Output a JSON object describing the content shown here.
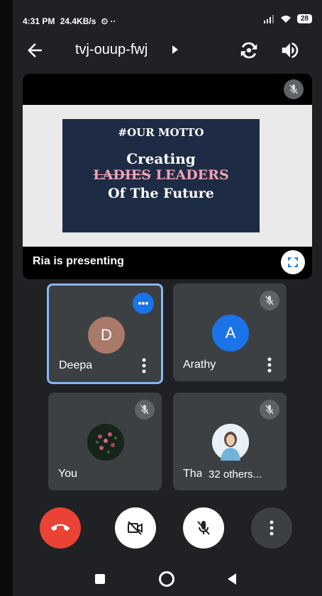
{
  "status": {
    "time": "4:31 PM",
    "speed": "24.4KB/s",
    "extra": "⏲ ··",
    "battery": "28"
  },
  "header": {
    "meeting_code": "tvj-ouup-fwj"
  },
  "presentation": {
    "slide": {
      "line1": "#OUR MOTTO",
      "line2": "Creating",
      "line3_struck": "LADIES",
      "line3_accent": "LEADERS",
      "line4": "Of The Future"
    },
    "label": "Ria is presenting"
  },
  "participants": [
    {
      "name": "Deepa",
      "initial": "D",
      "avatar_color": "#a9796a"
    },
    {
      "name": "Arathy",
      "initial": "A",
      "avatar_color": "#1a73e8"
    },
    {
      "name": "You"
    },
    {
      "name": "Tha",
      "others_label": "32 others..."
    }
  ],
  "colors": {
    "end_call": "#ea4335",
    "background": "#202124",
    "tile": "#3c4043",
    "active_border": "#8ab4f8"
  }
}
